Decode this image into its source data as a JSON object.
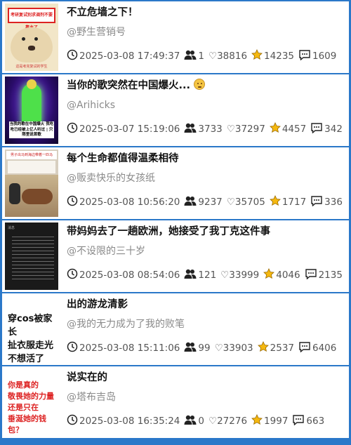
{
  "feed": {
    "items": [
      {
        "title": "不立危墙之下！",
        "author": "@野生营销号",
        "date": "2025-03-08 17:49:37",
        "users": "1",
        "likes": "♡38816",
        "stars": "14235",
        "comments": "1609",
        "thumb_text": "考研复试别求调剂不要靠主了",
        "thumb_caption": "这是考完复试的学生"
      },
      {
        "title": "当你的歌突然在中国爆火...",
        "author": "@Arihicks",
        "date": "2025-03-07 15:19:06",
        "users": "3733",
        "likes": "♡37297",
        "stars": "4457",
        "comments": "342",
        "thumb_text": "当我的歌在中国爆火 我吃吃已经被上亿人听过 | 只限里说首歌"
      },
      {
        "title": "每个生命都值得温柔相待",
        "author": "@贩卖快乐的女孩纸",
        "date": "2025-03-08 10:56:20",
        "users": "9237",
        "likes": "♡35705",
        "stars": "1717",
        "comments": "336",
        "thumb_text": "男子出马到海边带着一匹马"
      },
      {
        "title": "带妈妈去了一趟欧洲，她接受了我丁克这件事",
        "author": "@不设限的三十岁",
        "date": "2025-03-08 08:54:06",
        "users": "121",
        "likes": "♡33999",
        "stars": "4046",
        "comments": "2135",
        "thumb_text": "消息"
      },
      {
        "title": "出的游龙清影",
        "author": "@我的无力成为了我的败笔",
        "date": "2025-03-08 15:11:06",
        "users": "99",
        "likes": "♡33903",
        "stars": "2537",
        "comments": "6406",
        "thumb_lines": [
          "穿cos被家长",
          "扯衣服走光",
          "不想活了"
        ]
      },
      {
        "title": "说实在的",
        "author": "@塔布吉岛",
        "date": "2025-03-08 16:35:24",
        "users": "0",
        "likes": "♡27276",
        "stars": "1997",
        "comments": "663",
        "thumb_lines": [
          "你是真的",
          "敬畏她的力量",
          "还是只在",
          "垂涎她的钱包？"
        ]
      }
    ]
  },
  "icons": {
    "clock": "clock-icon",
    "users": "users-icon",
    "star": "star-icon",
    "comment": "comment-icon"
  },
  "colors": {
    "background": "#2b78c9",
    "card": "#ffffff",
    "star": "#f5b80f"
  }
}
